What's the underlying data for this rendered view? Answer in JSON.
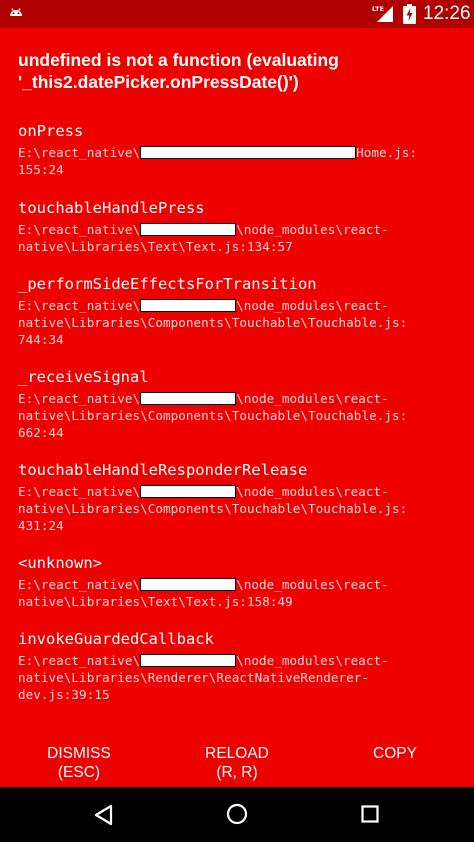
{
  "status_bar": {
    "time": "12:26",
    "network_label": "LTE",
    "icons": [
      "android-icon",
      "lte-signal-icon",
      "battery-charging-icon"
    ]
  },
  "redbox": {
    "title": "undefined is not a function (evaluating '_this2.datePicker.onPressDate()')",
    "background_color": "#ee0000",
    "stack": [
      {
        "method": "onPress",
        "location_lines": [
          "E:\\react_native\\",
          "Home.js:",
          "155:24"
        ]
      },
      {
        "method": "touchableHandlePress",
        "location_lines": [
          "E:\\react_native\\",
          "\\node_modules\\react-",
          "native\\Libraries\\Text\\Text.js:134:57"
        ]
      },
      {
        "method": "_performSideEffectsForTransition",
        "location_lines": [
          "E:\\react_native\\",
          "\\node_modules\\react-",
          "native\\Libraries\\Components\\Touchable\\Touchable.js:",
          "744:34"
        ]
      },
      {
        "method": "_receiveSignal",
        "location_lines": [
          "E:\\react_native\\",
          "\\node_modules\\react-",
          "native\\Libraries\\Components\\Touchable\\Touchable.js:",
          "662:44"
        ]
      },
      {
        "method": "touchableHandleResponderRelease",
        "location_lines": [
          "E:\\react_native\\",
          "\\node_modules\\react-",
          "native\\Libraries\\Components\\Touchable\\Touchable.js:",
          "431:24"
        ]
      },
      {
        "method": "<unknown>",
        "location_lines": [
          "E:\\react_native\\",
          "\\node_modules\\react-",
          "native\\Libraries\\Text\\Text.js:158:49"
        ]
      },
      {
        "method": "invokeGuardedCallback",
        "location_lines": [
          "E:\\react_native\\",
          "\\node_modules\\react-",
          "native\\Libraries\\Renderer\\ReactNativeRenderer-",
          "dev.js:39:15"
        ]
      }
    ]
  },
  "buttons": {
    "dismiss": {
      "line1": "DISMISS",
      "line2": "(ESC)"
    },
    "reload": {
      "line1": "RELOAD",
      "line2": "(R, R)"
    },
    "copy": {
      "line1": "COPY"
    }
  },
  "nav_bar": {
    "icons": [
      "back-icon",
      "home-icon",
      "recents-icon"
    ]
  }
}
